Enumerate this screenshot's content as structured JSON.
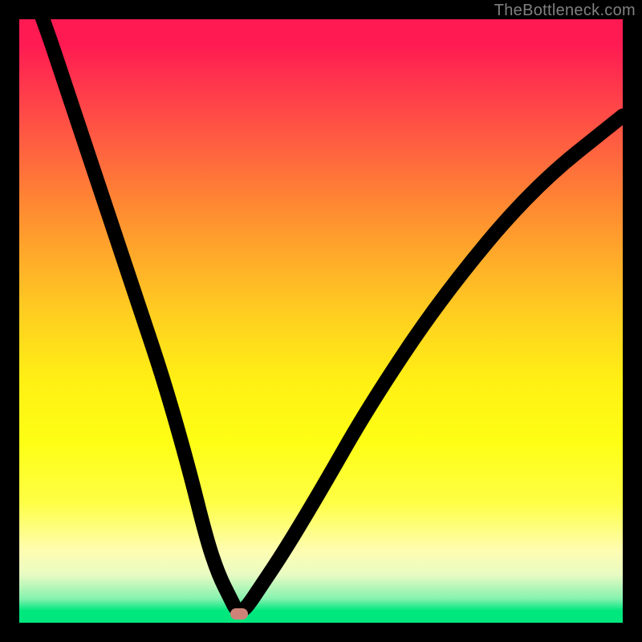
{
  "watermark": "TheBottleneck.com",
  "chart_data": {
    "type": "line",
    "title": "",
    "xlabel": "",
    "ylabel": "",
    "xlim": [
      0,
      100
    ],
    "ylim": [
      0,
      100
    ],
    "grid": false,
    "series": [
      {
        "name": "bottleneck-curve",
        "x": [
          0,
          4,
          8,
          12,
          16,
          20,
          24,
          28,
          31,
          33,
          35,
          36,
          37,
          38,
          40,
          44,
          50,
          58,
          70,
          85,
          100
        ],
        "y": [
          110,
          100,
          88,
          76,
          64,
          52,
          40,
          26,
          14,
          8,
          4,
          2,
          2,
          3,
          6,
          12,
          22,
          36,
          54,
          72,
          84
        ]
      }
    ],
    "marker": {
      "x": 36.5,
      "y": 1.5,
      "color": "#cf8378"
    },
    "gradient_stops": [
      {
        "pos": 0.0,
        "color": "#ff1a52"
      },
      {
        "pos": 0.5,
        "color": "#ffd21f"
      },
      {
        "pos": 0.88,
        "color": "#fefdb0"
      },
      {
        "pos": 0.98,
        "color": "#00e77e"
      }
    ]
  }
}
